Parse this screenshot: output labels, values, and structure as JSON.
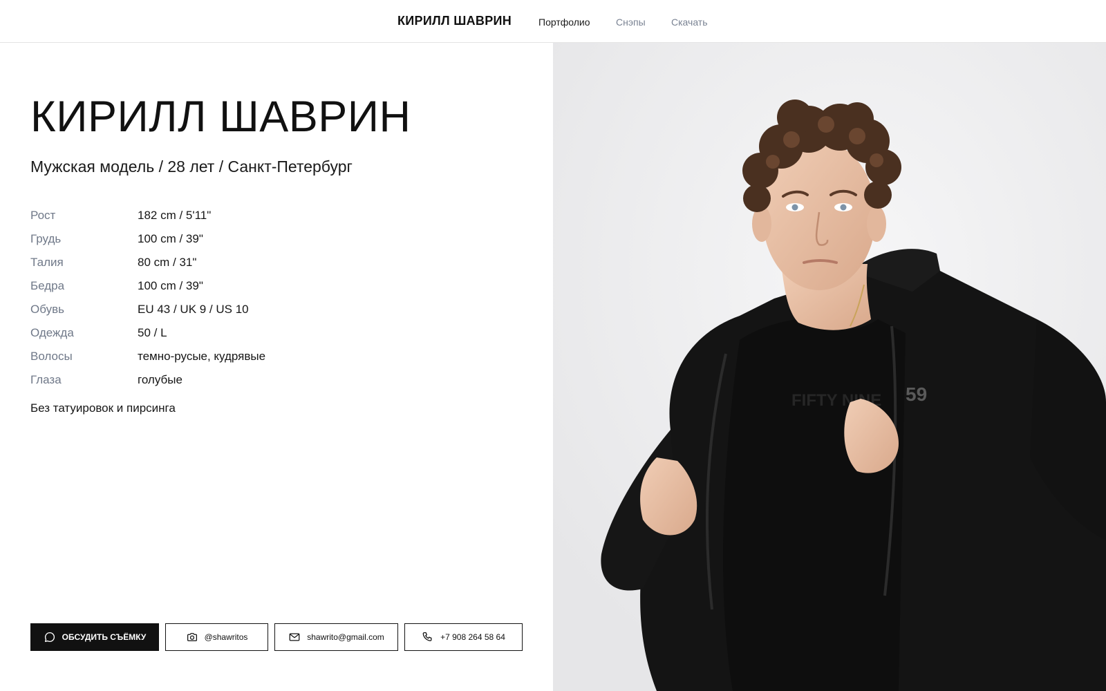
{
  "header": {
    "brand": "КИРИЛЛ ШАВРИН",
    "nav": [
      {
        "label": "Портфолио"
      },
      {
        "label": "Снэпы"
      },
      {
        "label": "Скачать"
      }
    ]
  },
  "profile": {
    "name": "КИРИЛЛ ШАВРИН",
    "subtitle": "Мужская модель / 28 лет / Санкт-Петербург",
    "specs": [
      {
        "label": "Рост",
        "value": "182 cm / 5'11\""
      },
      {
        "label": "Грудь",
        "value": "100 cm / 39\""
      },
      {
        "label": "Талия",
        "value": "80 cm / 31\""
      },
      {
        "label": "Бедра",
        "value": "100 cm / 39\""
      },
      {
        "label": "Обувь",
        "value": "EU 43 / UK 9 / US 10"
      },
      {
        "label": "Одежда",
        "value": "50 / L"
      },
      {
        "label": "Волосы",
        "value": "темно-русые, кудрявые"
      },
      {
        "label": "Глаза",
        "value": "голубые"
      }
    ],
    "note": "Без татуировок и пирсинга"
  },
  "contacts": {
    "primary_label": "ОБСУДИТЬ СЪЁМКУ",
    "instagram": "@shawritos",
    "email": "shawrito@gmail.com",
    "phone": "+7 908 264 58 64"
  },
  "photo": {
    "shirt_print": "FIFTY NINE",
    "sleeve_logo": "59"
  },
  "colors": {
    "accent": "#111111",
    "label_gray": "#6f7888",
    "nav_inactive": "#7a8393",
    "photo_background": "#efeff0"
  },
  "icons": [
    "chat-bubble-icon",
    "camera-icon",
    "mail-icon",
    "phone-icon"
  ]
}
